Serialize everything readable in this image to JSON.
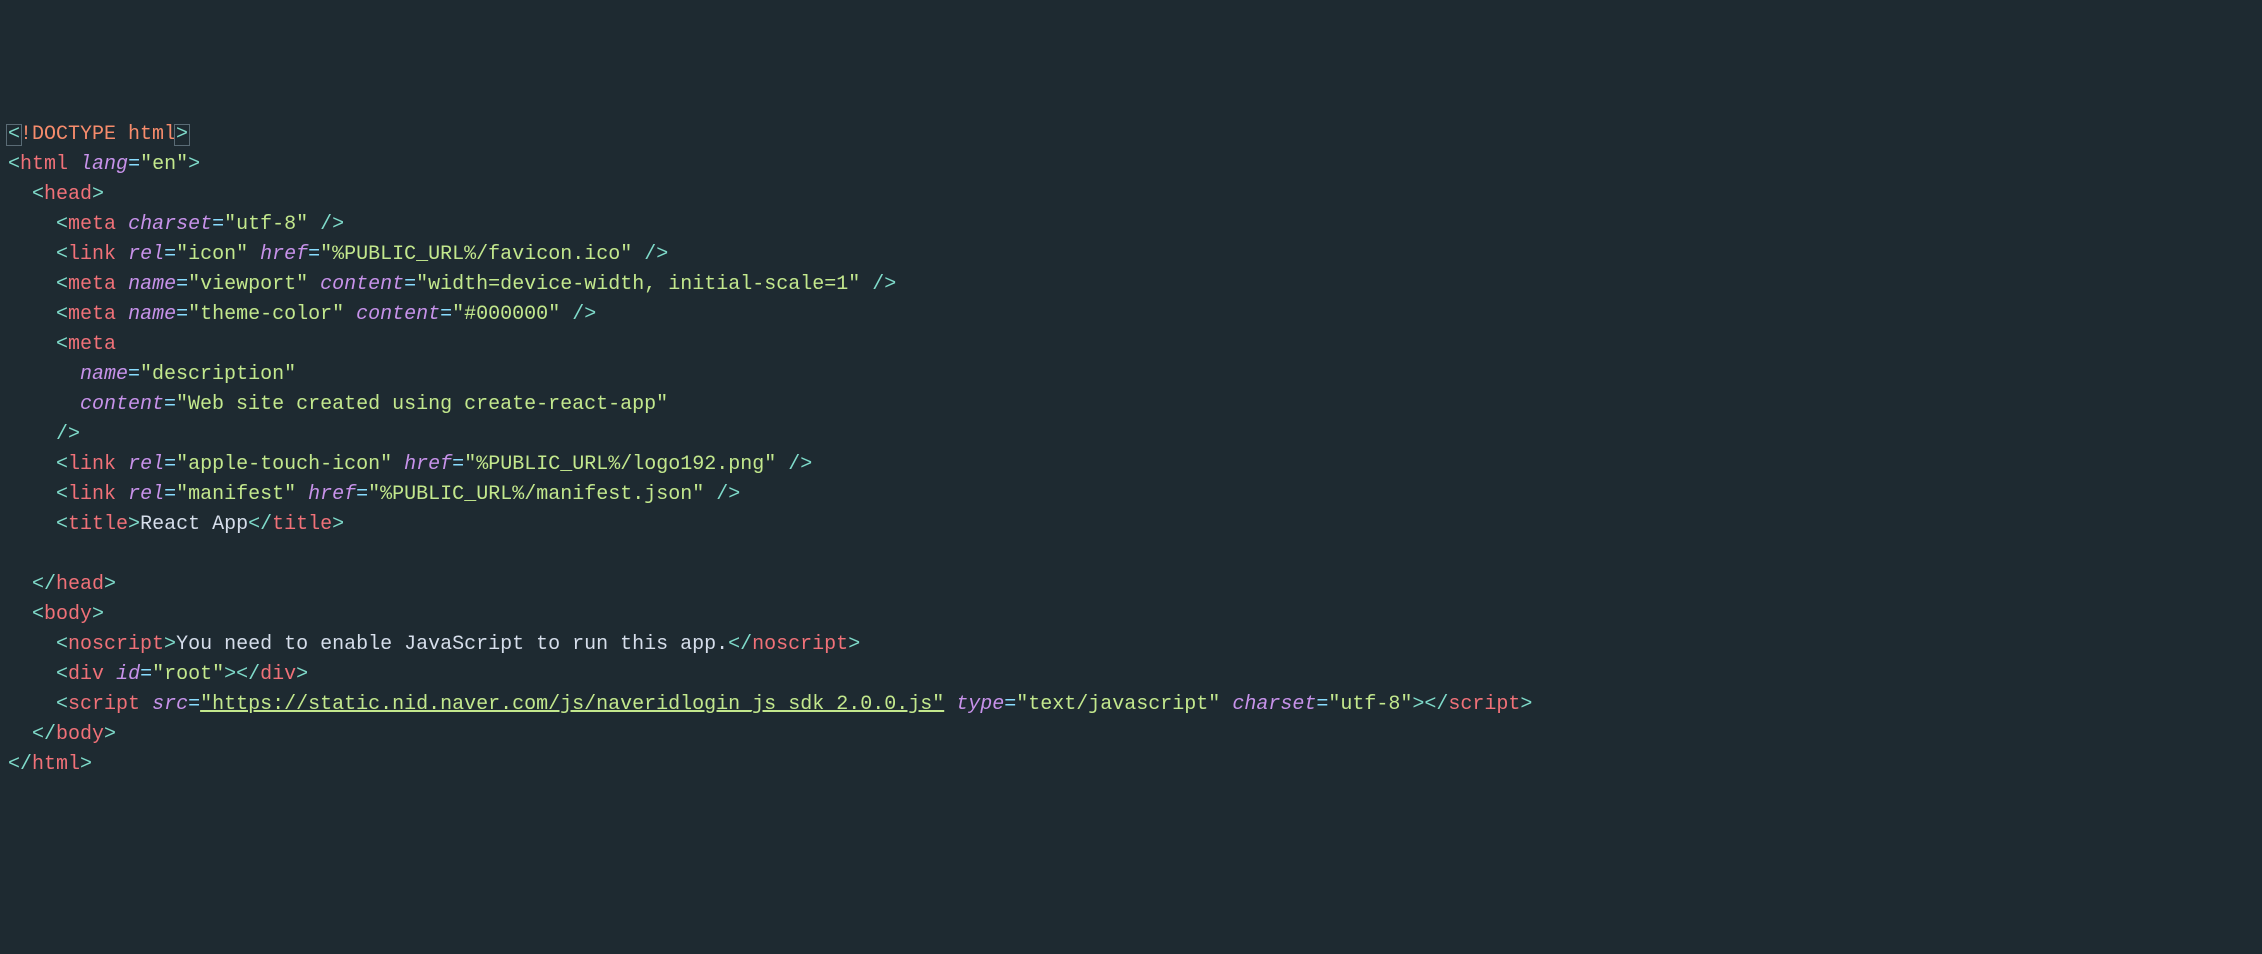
{
  "lines": [
    {
      "indent": 0,
      "parts": [
        {
          "t": "cursor-open",
          "v": "<"
        },
        {
          "t": "decl",
          "v": "!DOCTYPE html"
        },
        {
          "t": "cursor-close",
          "v": ">"
        }
      ]
    },
    {
      "indent": 0,
      "parts": [
        {
          "t": "bracket",
          "v": "<"
        },
        {
          "t": "tag",
          "v": "html"
        },
        {
          "t": "text",
          "v": " "
        },
        {
          "t": "attr",
          "v": "lang"
        },
        {
          "t": "eq",
          "v": "="
        },
        {
          "t": "str",
          "v": "\"en\""
        },
        {
          "t": "bracket",
          "v": ">"
        }
      ]
    },
    {
      "indent": 1,
      "parts": [
        {
          "t": "bracket",
          "v": "<"
        },
        {
          "t": "tag",
          "v": "head"
        },
        {
          "t": "bracket",
          "v": ">"
        }
      ]
    },
    {
      "indent": 2,
      "parts": [
        {
          "t": "bracket",
          "v": "<"
        },
        {
          "t": "tag",
          "v": "meta"
        },
        {
          "t": "text",
          "v": " "
        },
        {
          "t": "attr",
          "v": "charset"
        },
        {
          "t": "eq",
          "v": "="
        },
        {
          "t": "str",
          "v": "\"utf-8\""
        },
        {
          "t": "text",
          "v": " "
        },
        {
          "t": "bracket",
          "v": "/>"
        }
      ]
    },
    {
      "indent": 2,
      "parts": [
        {
          "t": "bracket",
          "v": "<"
        },
        {
          "t": "tag",
          "v": "link"
        },
        {
          "t": "text",
          "v": " "
        },
        {
          "t": "attr",
          "v": "rel"
        },
        {
          "t": "eq",
          "v": "="
        },
        {
          "t": "str",
          "v": "\"icon\""
        },
        {
          "t": "text",
          "v": " "
        },
        {
          "t": "attr",
          "v": "href"
        },
        {
          "t": "eq",
          "v": "="
        },
        {
          "t": "str",
          "v": "\"%PUBLIC_URL%/favicon.ico\""
        },
        {
          "t": "text",
          "v": " "
        },
        {
          "t": "bracket",
          "v": "/>"
        }
      ]
    },
    {
      "indent": 2,
      "parts": [
        {
          "t": "bracket",
          "v": "<"
        },
        {
          "t": "tag",
          "v": "meta"
        },
        {
          "t": "text",
          "v": " "
        },
        {
          "t": "attr",
          "v": "name"
        },
        {
          "t": "eq",
          "v": "="
        },
        {
          "t": "str",
          "v": "\"viewport\""
        },
        {
          "t": "text",
          "v": " "
        },
        {
          "t": "attr",
          "v": "content"
        },
        {
          "t": "eq",
          "v": "="
        },
        {
          "t": "str",
          "v": "\"width=device-width, initial-scale=1\""
        },
        {
          "t": "text",
          "v": " "
        },
        {
          "t": "bracket",
          "v": "/>"
        }
      ]
    },
    {
      "indent": 2,
      "parts": [
        {
          "t": "bracket",
          "v": "<"
        },
        {
          "t": "tag",
          "v": "meta"
        },
        {
          "t": "text",
          "v": " "
        },
        {
          "t": "attr",
          "v": "name"
        },
        {
          "t": "eq",
          "v": "="
        },
        {
          "t": "str",
          "v": "\"theme-color\""
        },
        {
          "t": "text",
          "v": " "
        },
        {
          "t": "attr",
          "v": "content"
        },
        {
          "t": "eq",
          "v": "="
        },
        {
          "t": "str",
          "v": "\"#000000\""
        },
        {
          "t": "text",
          "v": " "
        },
        {
          "t": "bracket",
          "v": "/>"
        }
      ]
    },
    {
      "indent": 2,
      "parts": [
        {
          "t": "bracket",
          "v": "<"
        },
        {
          "t": "tag",
          "v": "meta"
        }
      ]
    },
    {
      "indent": 3,
      "parts": [
        {
          "t": "attr",
          "v": "name"
        },
        {
          "t": "eq",
          "v": "="
        },
        {
          "t": "str",
          "v": "\"description\""
        }
      ]
    },
    {
      "indent": 3,
      "parts": [
        {
          "t": "attr",
          "v": "content"
        },
        {
          "t": "eq",
          "v": "="
        },
        {
          "t": "str",
          "v": "\"Web site created using create-react-app\""
        }
      ]
    },
    {
      "indent": 2,
      "parts": [
        {
          "t": "bracket",
          "v": "/>"
        }
      ]
    },
    {
      "indent": 2,
      "parts": [
        {
          "t": "bracket",
          "v": "<"
        },
        {
          "t": "tag",
          "v": "link"
        },
        {
          "t": "text",
          "v": " "
        },
        {
          "t": "attr",
          "v": "rel"
        },
        {
          "t": "eq",
          "v": "="
        },
        {
          "t": "str",
          "v": "\"apple-touch-icon\""
        },
        {
          "t": "text",
          "v": " "
        },
        {
          "t": "attr",
          "v": "href"
        },
        {
          "t": "eq",
          "v": "="
        },
        {
          "t": "str",
          "v": "\"%PUBLIC_URL%/logo192.png\""
        },
        {
          "t": "text",
          "v": " "
        },
        {
          "t": "bracket",
          "v": "/>"
        }
      ]
    },
    {
      "indent": 2,
      "parts": [
        {
          "t": "bracket",
          "v": "<"
        },
        {
          "t": "tag",
          "v": "link"
        },
        {
          "t": "text",
          "v": " "
        },
        {
          "t": "attr",
          "v": "rel"
        },
        {
          "t": "eq",
          "v": "="
        },
        {
          "t": "str",
          "v": "\"manifest\""
        },
        {
          "t": "text",
          "v": " "
        },
        {
          "t": "attr",
          "v": "href"
        },
        {
          "t": "eq",
          "v": "="
        },
        {
          "t": "str",
          "v": "\"%PUBLIC_URL%/manifest.json\""
        },
        {
          "t": "text",
          "v": " "
        },
        {
          "t": "bracket",
          "v": "/>"
        }
      ]
    },
    {
      "indent": 2,
      "parts": [
        {
          "t": "bracket",
          "v": "<"
        },
        {
          "t": "tag",
          "v": "title"
        },
        {
          "t": "bracket",
          "v": ">"
        },
        {
          "t": "text",
          "v": "React App"
        },
        {
          "t": "bracket",
          "v": "</"
        },
        {
          "t": "tag",
          "v": "title"
        },
        {
          "t": "bracket",
          "v": ">"
        }
      ]
    },
    {
      "indent": 2,
      "parts": []
    },
    {
      "indent": 1,
      "parts": [
        {
          "t": "bracket",
          "v": "</"
        },
        {
          "t": "tag",
          "v": "head"
        },
        {
          "t": "bracket",
          "v": ">"
        }
      ]
    },
    {
      "indent": 1,
      "parts": [
        {
          "t": "bracket",
          "v": "<"
        },
        {
          "t": "tag",
          "v": "body"
        },
        {
          "t": "bracket",
          "v": ">"
        }
      ]
    },
    {
      "indent": 2,
      "parts": [
        {
          "t": "bracket",
          "v": "<"
        },
        {
          "t": "tag",
          "v": "noscript"
        },
        {
          "t": "bracket",
          "v": ">"
        },
        {
          "t": "text",
          "v": "You need to enable JavaScript to run this app."
        },
        {
          "t": "bracket",
          "v": "</"
        },
        {
          "t": "tag",
          "v": "noscript"
        },
        {
          "t": "bracket",
          "v": ">"
        }
      ]
    },
    {
      "indent": 2,
      "parts": [
        {
          "t": "bracket",
          "v": "<"
        },
        {
          "t": "tag",
          "v": "div"
        },
        {
          "t": "text",
          "v": " "
        },
        {
          "t": "attr",
          "v": "id"
        },
        {
          "t": "eq",
          "v": "="
        },
        {
          "t": "str",
          "v": "\"root\""
        },
        {
          "t": "bracket",
          "v": "></"
        },
        {
          "t": "tag",
          "v": "div"
        },
        {
          "t": "bracket",
          "v": ">"
        }
      ]
    },
    {
      "indent": 2,
      "parts": [
        {
          "t": "bracket",
          "v": "<"
        },
        {
          "t": "tag",
          "v": "script"
        },
        {
          "t": "text",
          "v": " "
        },
        {
          "t": "attr",
          "v": "src"
        },
        {
          "t": "eq",
          "v": "="
        },
        {
          "t": "str-u",
          "v": "\"https://static.nid.naver.com/js/naveridlogin_js_sdk_2.0.0.js\""
        },
        {
          "t": "text",
          "v": " "
        },
        {
          "t": "attr",
          "v": "type"
        },
        {
          "t": "eq",
          "v": "="
        },
        {
          "t": "str",
          "v": "\"text/javascript\""
        },
        {
          "t": "text",
          "v": " "
        },
        {
          "t": "attr",
          "v": "charset"
        },
        {
          "t": "eq",
          "v": "="
        },
        {
          "t": "str",
          "v": "\"utf-8\""
        },
        {
          "t": "bracket",
          "v": "></"
        },
        {
          "t": "tag",
          "v": "script"
        },
        {
          "t": "bracket",
          "v": ">"
        }
      ]
    },
    {
      "indent": 1,
      "parts": [
        {
          "t": "bracket",
          "v": "</"
        },
        {
          "t": "tag",
          "v": "body"
        },
        {
          "t": "bracket",
          "v": ">"
        }
      ]
    },
    {
      "indent": 0,
      "parts": [
        {
          "t": "bracket",
          "v": "</"
        },
        {
          "t": "tag",
          "v": "html"
        },
        {
          "t": "bracket",
          "v": ">"
        }
      ]
    }
  ],
  "indentSize": 2,
  "indentChar": "  "
}
